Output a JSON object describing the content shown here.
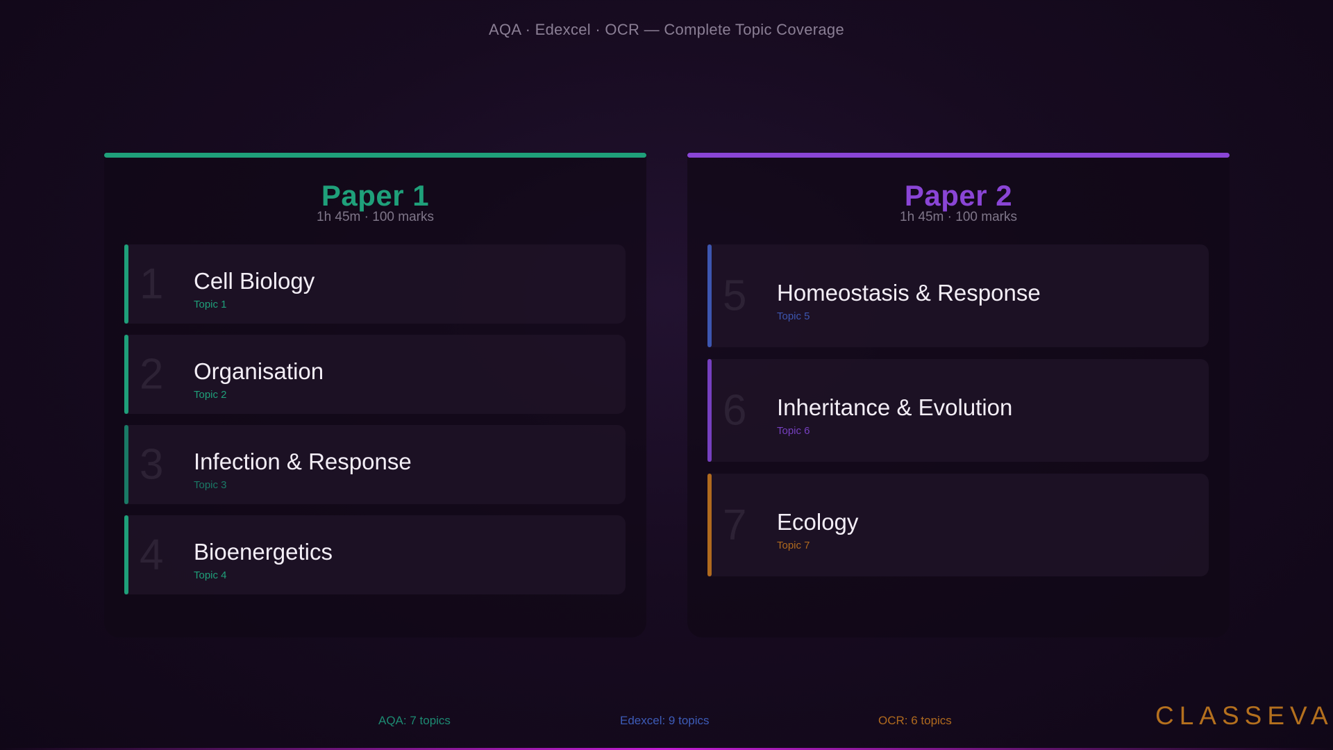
{
  "header": {
    "subtitle": "AQA · Edexcel · OCR — Complete Topic Coverage"
  },
  "papers": [
    {
      "title": "Paper 1",
      "meta": "1h 45m · 100 marks",
      "color": "#1fa07a",
      "topics": [
        {
          "num": "1",
          "name": "Cell Biology",
          "tag": "Topic 1",
          "color": "#1fa07a"
        },
        {
          "num": "2",
          "name": "Organisation",
          "tag": "Topic 2",
          "color": "#1fa07a"
        },
        {
          "num": "3",
          "name": "Infection & Response",
          "tag": "Topic 3",
          "color": "#1a7a66"
        },
        {
          "num": "4",
          "name": "Bioenergetics",
          "tag": "Topic 4",
          "color": "#1fa07a"
        }
      ]
    },
    {
      "title": "Paper 2",
      "meta": "1h 45m · 100 marks",
      "color": "#8a45d6",
      "topics": [
        {
          "num": "5",
          "name": "Homeostasis & Response",
          "tag": "Topic 5",
          "color": "#3d56b0"
        },
        {
          "num": "6",
          "name": "Inheritance & Evolution",
          "tag": "Topic 6",
          "color": "#7640c0"
        },
        {
          "num": "7",
          "name": "Ecology",
          "tag": "Topic 7",
          "color": "#b06a1e"
        }
      ]
    }
  ],
  "footer": {
    "aqa": {
      "label": "AQA: 7 topics",
      "color": "#1d8a72"
    },
    "edexcel": {
      "label": "Edexcel: 9 topics",
      "color": "#3d5cb8"
    },
    "ocr": {
      "label": "OCR: 6 topics",
      "color": "#b06a1e"
    }
  },
  "brand": {
    "logo": "CLASSEVA",
    "color": "#b4701e"
  }
}
